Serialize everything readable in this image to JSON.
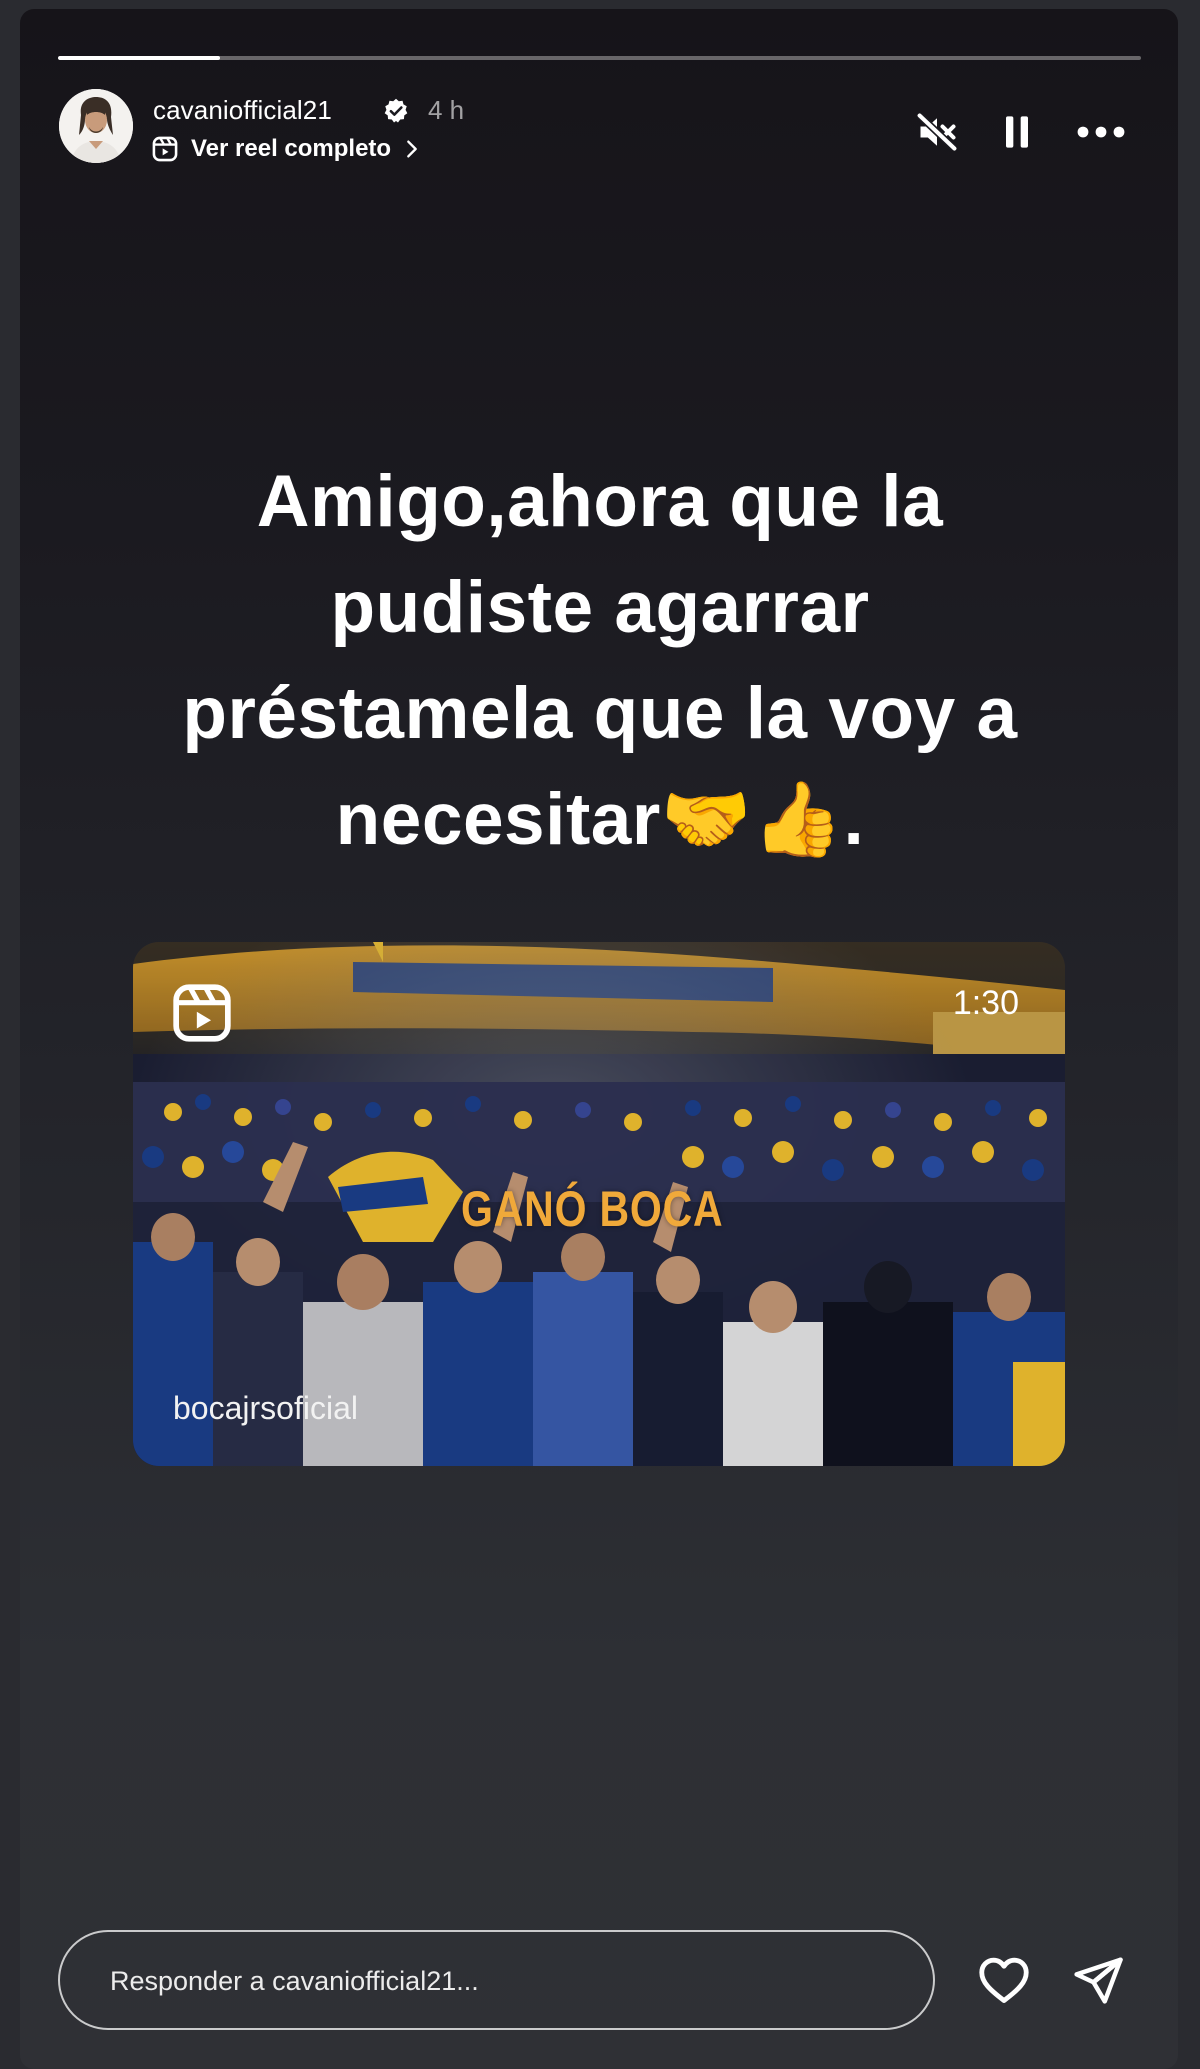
{
  "story": {
    "progress_fraction": 0.15,
    "username": "cavaniofficial21",
    "time_ago": "4 h",
    "reel_link_label": "Ver reel completo",
    "caption_lines": [
      "Amigo,ahora que la",
      "pudiste agarrar",
      "préstamela que la voy a",
      "necesitar🤝👍."
    ]
  },
  "reel": {
    "duration": "1:30",
    "owner": "bocajrsoficial",
    "banner_text": "GANÓ BOCA"
  },
  "reply": {
    "placeholder": "Responder a cavaniofficial21..."
  },
  "icons": {
    "verified": "verified-badge-icon",
    "reel_link": "reels-icon",
    "mute": "speaker-muted-icon",
    "pause": "pause-icon",
    "more": "more-options-icon",
    "like": "heart-icon",
    "share": "send-icon"
  },
  "colors": {
    "background": "#2a2b30",
    "text": "#ffffff",
    "banner": "#f0a93a",
    "crowd_blue": "#1c3f8c",
    "crowd_yellow": "#f2c230"
  }
}
